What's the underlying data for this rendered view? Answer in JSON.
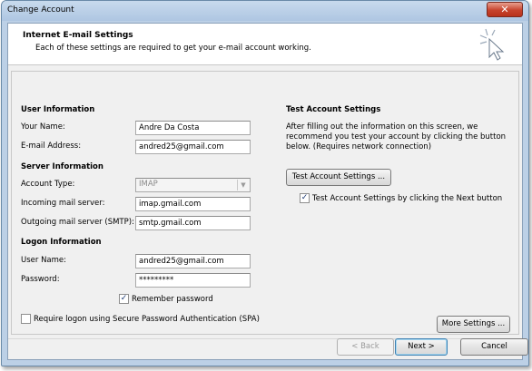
{
  "window": {
    "title": "Change Account",
    "close_glyph": "✕"
  },
  "header": {
    "title": "Internet E-mail Settings",
    "subtitle": "Each of these settings are required to get your e-mail account working."
  },
  "user_info": {
    "heading": "User Information",
    "name_label": "Your Name:",
    "name_value": "Andre Da Costa",
    "email_label": "E-mail Address:",
    "email_value": "andred25@gmail.com"
  },
  "server_info": {
    "heading": "Server Information",
    "account_type_label": "Account Type:",
    "account_type_value": "IMAP",
    "incoming_label": "Incoming mail server:",
    "incoming_value": "imap.gmail.com",
    "outgoing_label": "Outgoing mail server (SMTP):",
    "outgoing_value": "smtp.gmail.com"
  },
  "logon_info": {
    "heading": "Logon Information",
    "username_label": "User Name:",
    "username_value": "andred25@gmail.com",
    "password_label": "Password:",
    "password_value": "*********",
    "remember_label": "Remember password",
    "remember_checked": true,
    "spa_label": "Require logon using Secure Password Authentication (SPA)",
    "spa_checked": false
  },
  "test_settings": {
    "heading": "Test Account Settings",
    "description": "After filling out the information on this screen, we recommend you test your account by clicking the button below. (Requires network connection)",
    "test_button": "Test Account Settings ...",
    "auto_test_label": "Test Account Settings by clicking the Next button",
    "auto_test_checked": true,
    "more_settings_button": "More Settings ..."
  },
  "footer": {
    "back_button": "< Back",
    "next_button": "Next >",
    "cancel_button": "Cancel"
  },
  "icons": {
    "checkmark": "✓",
    "dropdown": "▼"
  }
}
